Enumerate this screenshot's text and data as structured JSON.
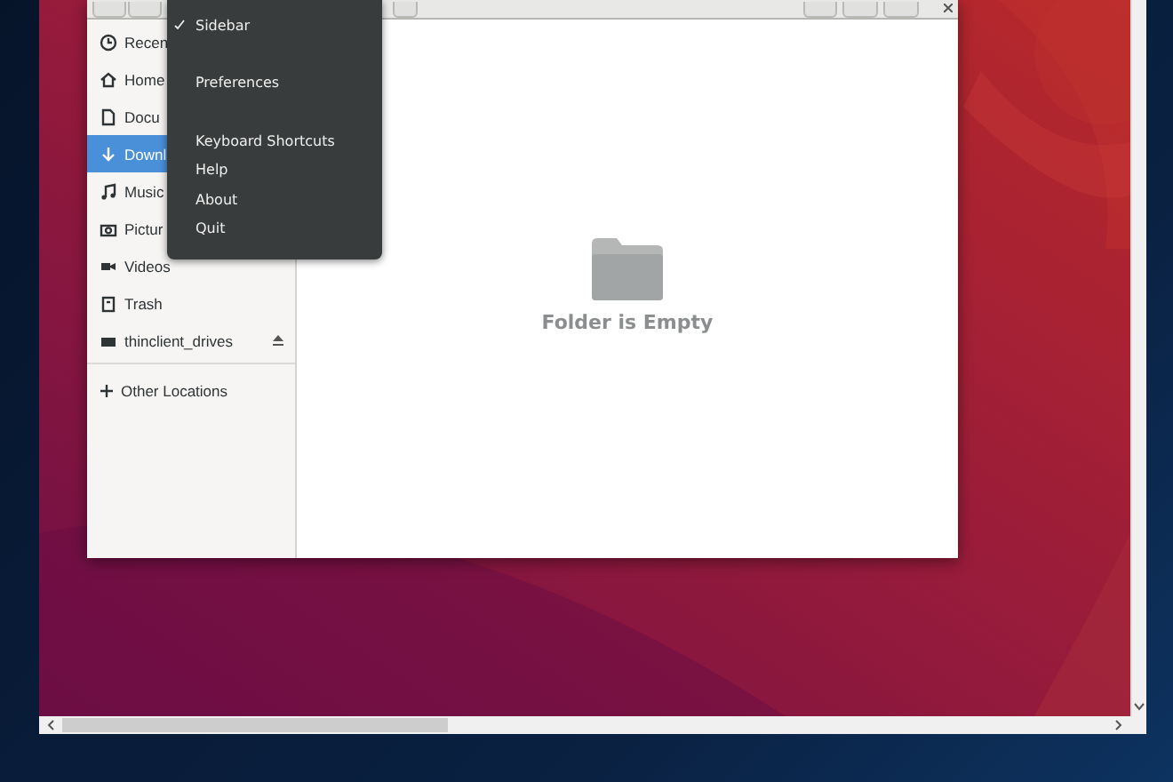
{
  "sidebar": {
    "items": [
      {
        "label": "Recen",
        "kind": "clock",
        "selected": false,
        "eject": false
      },
      {
        "label": "Home",
        "kind": "home",
        "selected": false,
        "eject": false
      },
      {
        "label": "Docu",
        "kind": "document",
        "selected": false,
        "eject": false
      },
      {
        "label": "Downl",
        "kind": "download",
        "selected": true,
        "eject": false
      },
      {
        "label": "Music",
        "kind": "music",
        "selected": false,
        "eject": false
      },
      {
        "label": "Pictur",
        "kind": "camera",
        "selected": false,
        "eject": false
      },
      {
        "label": "Videos",
        "kind": "video",
        "selected": false,
        "eject": false
      },
      {
        "label": "Trash",
        "kind": "trash",
        "selected": false,
        "eject": false
      },
      {
        "label": "thinclient_drives",
        "kind": "drive",
        "selected": false,
        "eject": true
      }
    ],
    "other_locations": {
      "label": "Other Locations"
    }
  },
  "menu": {
    "groups": [
      [
        {
          "label": "Sidebar",
          "checked": true
        }
      ],
      [
        {
          "label": "Preferences",
          "checked": false
        }
      ],
      [
        {
          "label": "Keyboard Shortcuts",
          "checked": false
        },
        {
          "label": "Help",
          "checked": false
        },
        {
          "label": "About",
          "checked": false
        },
        {
          "label": "Quit",
          "checked": false
        }
      ]
    ]
  },
  "empty_state": {
    "text": "Folder is Empty"
  }
}
